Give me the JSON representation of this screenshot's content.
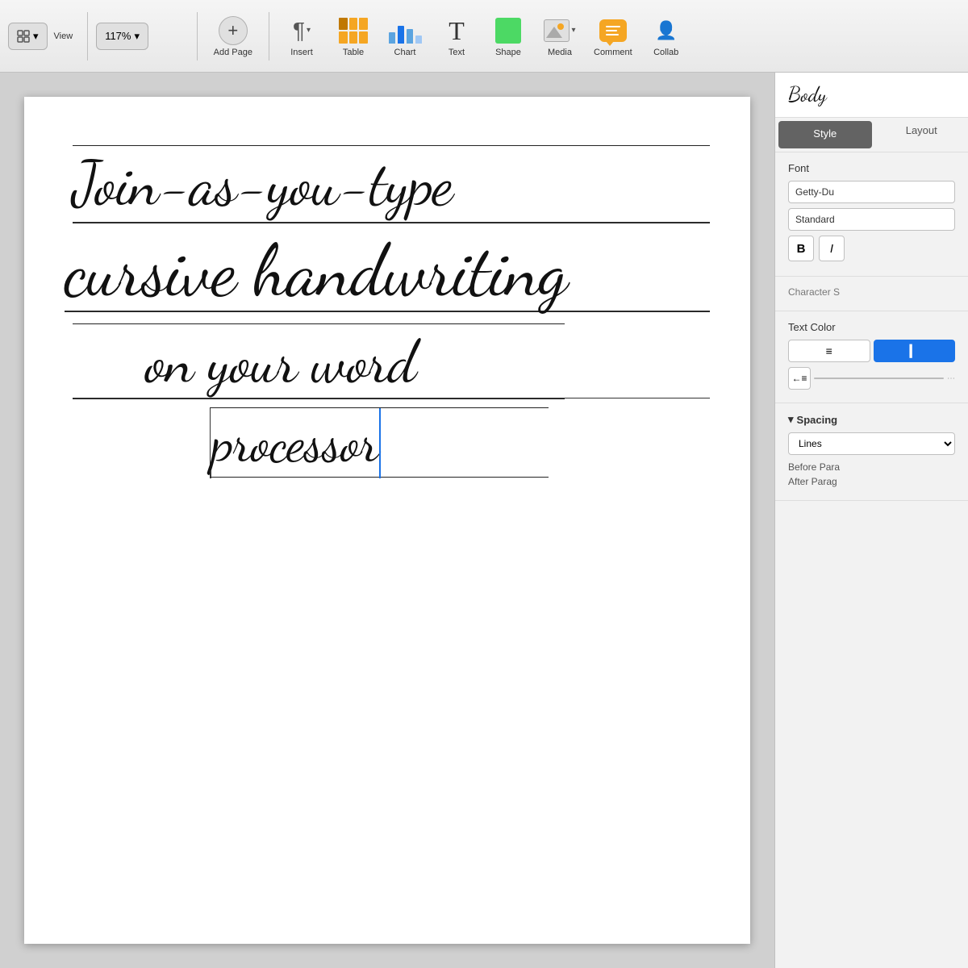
{
  "toolbar": {
    "view_label": "View",
    "zoom_value": "117%",
    "zoom_chevron": "▾",
    "add_page_label": "Add Page",
    "insert_label": "Insert",
    "table_label": "Table",
    "chart_label": "Chart",
    "text_label": "Text",
    "shape_label": "Shape",
    "media_label": "Media",
    "comment_label": "Comment",
    "collab_label": "Collab"
  },
  "document": {
    "line1": "Join-as-you-type",
    "line2": "cursive handwriting",
    "line3": "on your word",
    "line4": "processor"
  },
  "panel": {
    "header_text": "Body",
    "tab_style": "Style",
    "tab_layout": "Layout",
    "font_label": "Font",
    "font_name": "Getty-Du",
    "font_style": "Standard",
    "bold_label": "B",
    "italic_label": "I",
    "char_spacing_label": "Character S",
    "text_color_label": "Text Color",
    "align_left": "≡",
    "align_right": "▋",
    "spacing_label": "Spacing",
    "spacing_chevron": "▾",
    "lines_label": "Lines",
    "before_para_label": "Before Para",
    "after_para_label": "After Parag"
  }
}
